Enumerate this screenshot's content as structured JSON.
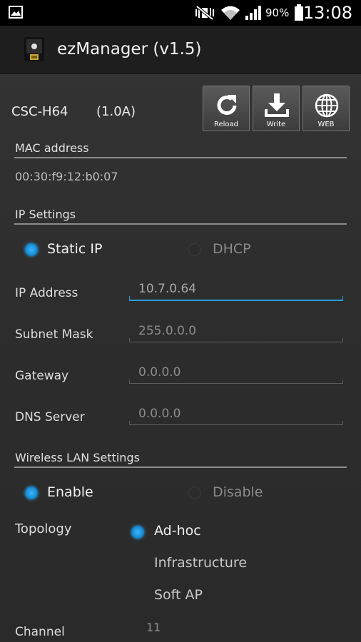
{
  "status_bar": {
    "battery": "90%",
    "time": "13:08"
  },
  "app_bar": {
    "title": "ezManager (v1.5)"
  },
  "device": {
    "model": "CSC-H64",
    "version": "(1.0A)"
  },
  "toolbar": {
    "reload_label": "Reload",
    "write_label": "Write",
    "web_label": "WEB"
  },
  "mac": {
    "header": "MAC address",
    "value": "00:30:f9:12:b0:07"
  },
  "ip_settings": {
    "header": "IP Settings",
    "mode_static": "Static IP",
    "mode_dhcp": "DHCP",
    "selected_mode": "Static IP",
    "ip_label": "IP Address",
    "ip_value": "10.7.0.64",
    "subnet_label": "Subnet Mask",
    "subnet_value": "255.0.0.0",
    "gateway_label": "Gateway",
    "gateway_value": "0.0.0.0",
    "dns_label": "DNS Server",
    "dns_value": "0.0.0.0"
  },
  "wlan": {
    "header": "Wireless LAN Settings",
    "enable_label": "Enable",
    "disable_label": "Disable",
    "selected": "Enable",
    "topology_label": "Topology",
    "topology_options": [
      "Ad-hoc",
      "Infrastructure",
      "Soft AP"
    ],
    "topology_selected": "Ad-hoc",
    "channel_label": "Channel",
    "channel_value": "11"
  },
  "colors": {
    "accent": "#2a9bd9",
    "background": "#2b2b2b",
    "app_bar": "#1e1e1e"
  }
}
